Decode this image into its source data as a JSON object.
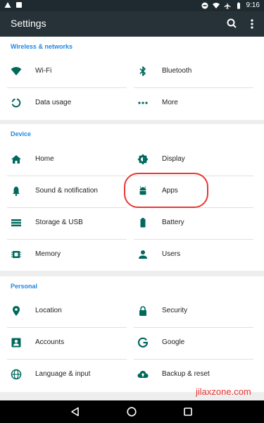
{
  "status": {
    "time": "9:16"
  },
  "header": {
    "title": "Settings"
  },
  "sections": {
    "wireless": {
      "title": "Wireless & networks",
      "items": [
        {
          "label": "Wi-Fi",
          "icon": "wifi-icon"
        },
        {
          "label": "Bluetooth",
          "icon": "bluetooth-icon"
        },
        {
          "label": "Data usage",
          "icon": "data-usage-icon"
        },
        {
          "label": "More",
          "icon": "more-horizontal-icon"
        }
      ]
    },
    "device": {
      "title": "Device",
      "items": [
        {
          "label": "Home",
          "icon": "home-icon"
        },
        {
          "label": "Display",
          "icon": "brightness-icon"
        },
        {
          "label": "Sound & notification",
          "icon": "bell-icon"
        },
        {
          "label": "Apps",
          "icon": "android-icon"
        },
        {
          "label": "Storage & USB",
          "icon": "storage-icon"
        },
        {
          "label": "Battery",
          "icon": "battery-icon"
        },
        {
          "label": "Memory",
          "icon": "memory-icon"
        },
        {
          "label": "Users",
          "icon": "person-icon"
        }
      ]
    },
    "personal": {
      "title": "Personal",
      "items": [
        {
          "label": "Location",
          "icon": "location-pin-icon"
        },
        {
          "label": "Security",
          "icon": "lock-icon"
        },
        {
          "label": "Accounts",
          "icon": "account-box-icon"
        },
        {
          "label": "Google",
          "icon": "google-icon"
        },
        {
          "label": "Language & input",
          "icon": "globe-icon"
        },
        {
          "label": "Backup & reset",
          "icon": "cloud-upload-icon"
        }
      ]
    }
  },
  "watermark": "jilaxzone.com",
  "colors": {
    "appbar": "#263238",
    "accent": "#1e88e5",
    "icon": "#00695c",
    "highlight": "#e53935"
  }
}
